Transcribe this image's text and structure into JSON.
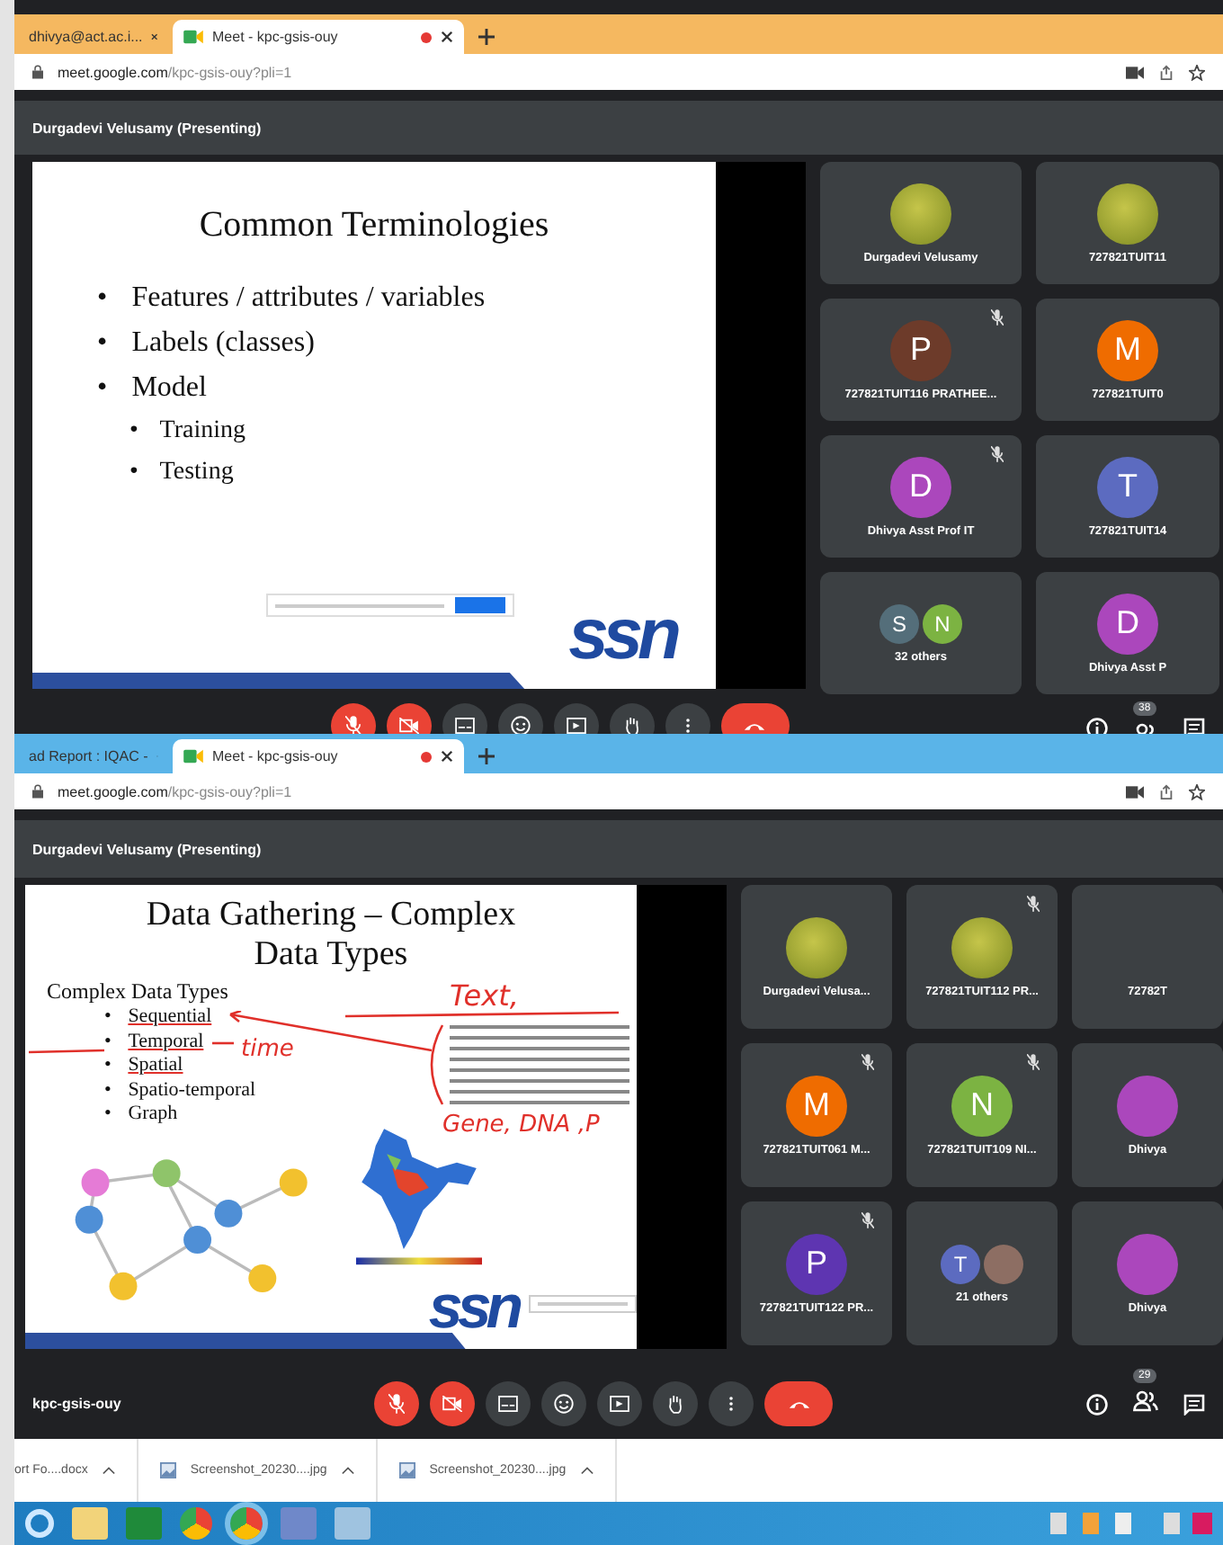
{
  "screenshots": [
    {
      "tabs": [
        {
          "label": "dhivya@act.ac.i...",
          "selected": false,
          "recording": false
        },
        {
          "label": "Meet - kpc-gsis-ouy",
          "selected": true,
          "recording": true
        }
      ],
      "url_host": "meet.google.com",
      "url_path": "/kpc-gsis-ouy?pli=1",
      "presenter": "Durgadevi Velusamy (Presenting)",
      "slide": {
        "kind": "bullets",
        "title": "Common Terminologies",
        "logo": "ssn",
        "marker": "•",
        "bullets": [
          {
            "text": "Features / attributes / variables"
          },
          {
            "text": "Labels (classes)"
          },
          {
            "text": "Model",
            "children": [
              {
                "text": "Training"
              },
              {
                "text": "Testing"
              }
            ]
          }
        ]
      },
      "tiles": [
        {
          "kind": "photo",
          "name": "Durgadevi Velusamy",
          "muted": false
        },
        {
          "kind": "photo",
          "name": "727821TUIT11",
          "muted": false
        },
        {
          "kind": "letter",
          "letter": "P",
          "color": "#6d3b2a",
          "name": "727821TUIT116 PRATHEE...",
          "muted": true
        },
        {
          "kind": "letter",
          "letter": "M",
          "color": "#ef6c00",
          "name": "727821TUIT0",
          "muted": false
        },
        {
          "kind": "letter",
          "letter": "D",
          "color": "#ab47bc",
          "name": "Dhivya Asst Prof IT",
          "muted": true
        },
        {
          "kind": "letter",
          "letter": "T",
          "color": "#5c6bc0",
          "name": "727821TUIT14",
          "muted": false
        },
        {
          "kind": "group",
          "avatars": [
            {
              "letter": "S",
              "color": "#546e7a"
            },
            {
              "letter": "N",
              "color": "#7cb342"
            }
          ],
          "name": "32 others",
          "muted": false
        },
        {
          "kind": "letter",
          "letter": "D",
          "color": "#ab47bc",
          "name": "Dhivya Asst P",
          "muted": false
        }
      ],
      "controls": {
        "mic_on": false,
        "camera_on": false,
        "people_count": "38"
      }
    },
    {
      "tabs": [
        {
          "label": "ad Report : IQAC -",
          "selected": false,
          "recording": false
        },
        {
          "label": "Meet - kpc-gsis-ouy",
          "selected": true,
          "recording": true
        }
      ],
      "url_host": "meet.google.com",
      "url_path": "/kpc-gsis-ouy?pli=1",
      "presenter": "Durgadevi Velusamy (Presenting)",
      "slide": {
        "kind": "data-types",
        "title": "Data Gathering – Complex Data Types",
        "subtitle": "Complex Data Types",
        "logo": "ssn",
        "marker": "•",
        "bullets": [
          {
            "text": "Sequential",
            "underlined": true
          },
          {
            "text": "Temporal",
            "underlined": true
          },
          {
            "text": "Spatial",
            "underlined": true
          },
          {
            "text": "Spatio-temporal",
            "underlined": false
          },
          {
            "text": "Graph",
            "underlined": false
          }
        ],
        "annotations": [
          "Text,",
          "time",
          "Gene, DNA ,P"
        ]
      },
      "tiles": [
        {
          "kind": "photo",
          "name": "Durgadevi Velusa...",
          "muted": false
        },
        {
          "kind": "photo",
          "name": "727821TUIT112 PR...",
          "muted": true
        },
        {
          "kind": "blank",
          "name": "72782T",
          "muted": false
        },
        {
          "kind": "letter",
          "letter": "M",
          "color": "#ef6c00",
          "name": "727821TUIT061 M...",
          "muted": true
        },
        {
          "kind": "letter",
          "letter": "N",
          "color": "#7cb342",
          "name": "727821TUIT109 NI...",
          "muted": true
        },
        {
          "kind": "blank",
          "color": "#ab47bc",
          "name": "Dhivya",
          "muted": false
        },
        {
          "kind": "letter",
          "letter": "P",
          "color": "#5e35b1",
          "name": "727821TUIT122 PR...",
          "muted": true
        },
        {
          "kind": "group",
          "avatars": [
            {
              "letter": "T",
              "color": "#5c6bc0"
            },
            {
              "color": "#8d6e63"
            }
          ],
          "name": "21 others",
          "muted": false
        },
        {
          "kind": "blank",
          "color": "#ab47bc",
          "name": "Dhivya",
          "muted": false
        }
      ],
      "controls": {
        "meeting_code": "kpc-gsis-ouy",
        "mic_on": false,
        "camera_on": false,
        "people_count": "29"
      }
    }
  ],
  "downloads": [
    {
      "name": "ort Fo....docx"
    },
    {
      "name": "Screenshot_20230....jpg"
    },
    {
      "name": "Screenshot_20230....jpg"
    }
  ]
}
